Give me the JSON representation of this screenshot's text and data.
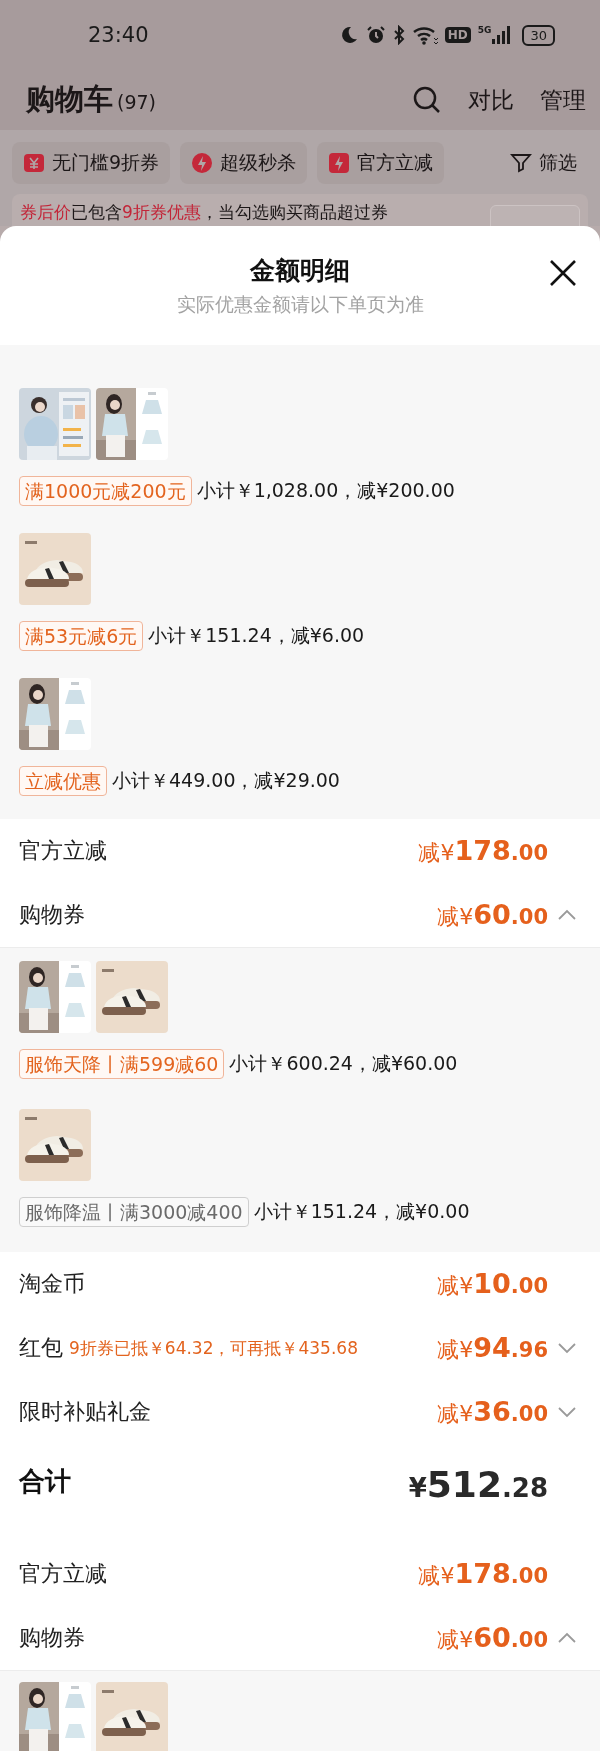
{
  "status_bar": {
    "time": "23:40",
    "hd": "HD",
    "network": "5G",
    "battery": "30"
  },
  "header": {
    "title": "购物车",
    "count": "(97)",
    "actions": [
      "对比",
      "管理"
    ]
  },
  "filter_chips": [
    {
      "kind": "coupon",
      "label": "无门槛9折券"
    },
    {
      "kind": "flash",
      "label": "超级秒杀"
    },
    {
      "kind": "instant",
      "label": "官方立减"
    },
    {
      "kind": "filter",
      "label": "筛选"
    }
  ],
  "notice": {
    "text": "**券后价**已包含**9折券优惠**，当勾选购买商品超过券"
  },
  "sheet": {
    "title": "金额明细",
    "subtitle": "实际优惠金额请以下单页为准",
    "blocks": [
      {
        "kind": "groups",
        "groups": [
          {
            "tag": "满1000元减200元",
            "met": true,
            "subtotal": "小计￥1,028.00，减¥200.00"
          },
          {
            "tag": "满53元减6元",
            "met": true,
            "subtotal": "小计￥151.24，减¥6.00"
          },
          {
            "tag": "立减优惠",
            "met": true,
            "subtotal": "小计￥449.00，减¥29.00"
          }
        ]
      },
      {
        "kind": "rows",
        "rows": [
          {
            "kind": "item",
            "label": "官方立减",
            "amount": "减¥178.00"
          },
          {
            "kind": "item",
            "label": "购物券",
            "amount": "减¥60.00",
            "expanded": true
          }
        ]
      },
      {
        "kind": "groups",
        "groups": [
          {
            "tag": "服饰天降丨满599减60",
            "met": true,
            "subtotal": "小计￥600.24，减¥60.00"
          },
          {
            "tag": "服饰降温丨满3000减400",
            "met": false,
            "subtotal": "小计￥151.24，减¥0.00"
          }
        ]
      },
      {
        "kind": "rows",
        "rows": [
          {
            "kind": "item",
            "label": "淘金币",
            "amount": "减¥10.00"
          },
          {
            "kind": "item",
            "label": "红包",
            "note": "9折券已抵￥64.32，可再抵￥435.68",
            "amount": "减¥94.96",
            "expanded": false
          },
          {
            "kind": "item",
            "label": "限时补贴礼金",
            "amount": "减¥36.00",
            "expanded": false
          },
          {
            "kind": "total",
            "label": "合计",
            "amount": "¥512.28"
          },
          {
            "kind": "item",
            "label": "官方立减",
            "amount": "减¥178.00"
          },
          {
            "kind": "item",
            "label": "购物券",
            "amount": "减¥60.00",
            "expanded": true
          }
        ]
      },
      {
        "kind": "groups"
      }
    ]
  }
}
